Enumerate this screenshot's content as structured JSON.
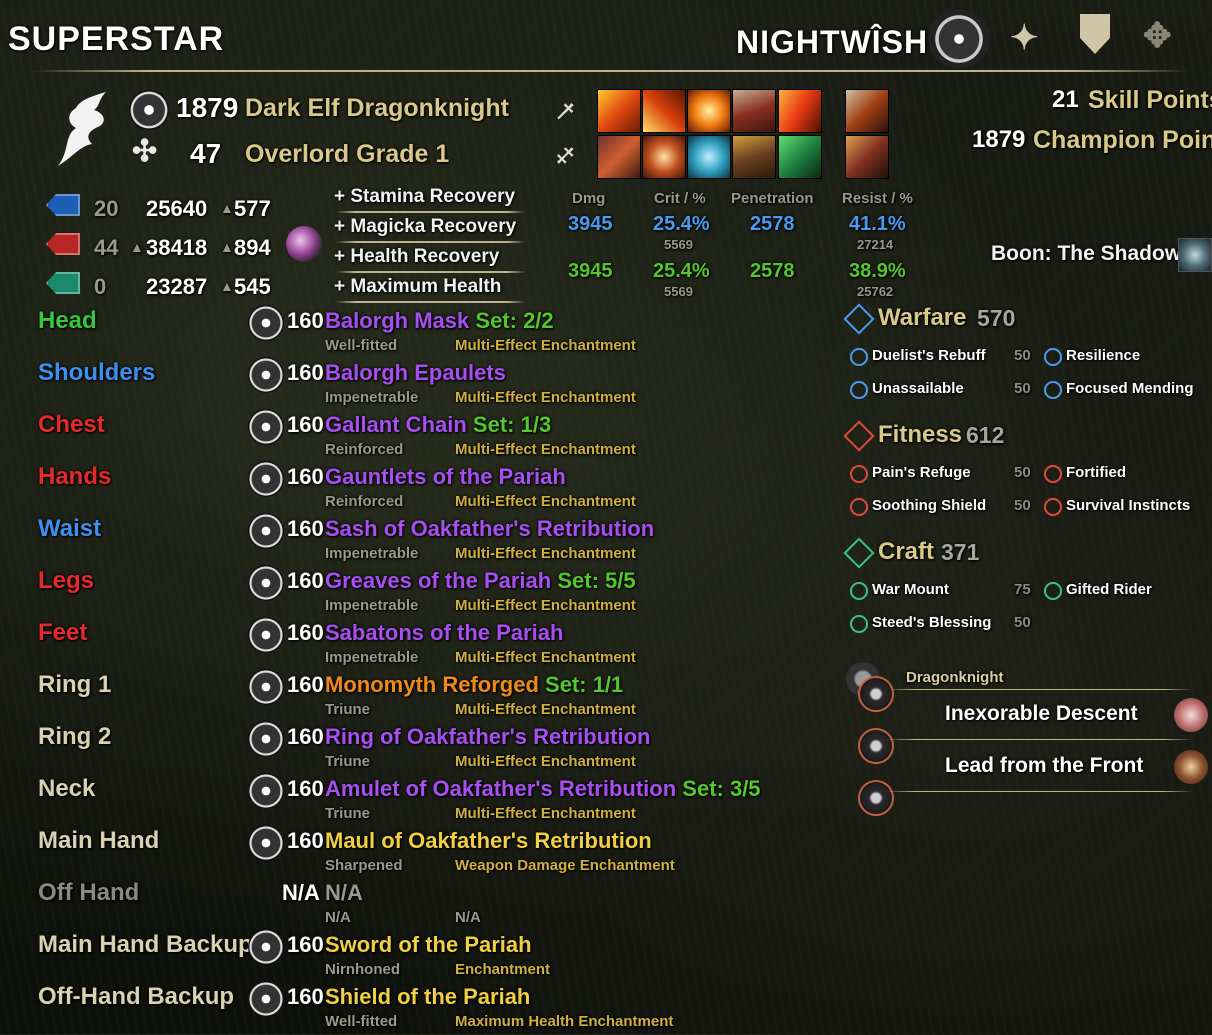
{
  "header": {
    "account": "SUPERSTAR",
    "character": "NIGHTWÎSH",
    "icons": [
      "cp-emblem-icon",
      "alliance-rank-icon",
      "shield-icon",
      "dragon-crest-icon"
    ]
  },
  "profile": {
    "cp": "1879",
    "race_class": "Dark Elf Dragonknight",
    "level": "47",
    "rank": "Overlord Grade 1",
    "skill_points_value": "21",
    "skill_points_label": "Skill Points",
    "champion_points_value": "1879",
    "champion_points_label": "Champion Points"
  },
  "resources": [
    {
      "color": "#1d5fb4",
      "attr": "20",
      "value": "25640",
      "arrow": "▲",
      "regen": "577"
    },
    {
      "color": "#b82626",
      "attr": "44",
      "value": "38418",
      "arrow": "▲",
      "regen": "894",
      "prefix": "▲"
    },
    {
      "color": "#1a8a6c",
      "attr": "0",
      "value": "23287",
      "arrow": "▲",
      "regen": "545"
    }
  ],
  "mundus": [
    "+ Stamina Recovery",
    "+ Magicka Recovery",
    "+ Health Recovery",
    "+ Maximum Health"
  ],
  "combat": {
    "headers": [
      "Dmg",
      "Crit / %",
      "Penetration",
      "Resist / %"
    ],
    "rows": [
      {
        "dmg": "3945",
        "crit": "25.4%",
        "crit_raw": "5569",
        "pen": "2578",
        "resist": "41.1%",
        "resist_raw": "27214",
        "color": "#4a9bf0"
      },
      {
        "dmg": "3945",
        "crit": "25.4%",
        "crit_raw": "5569",
        "pen": "2578",
        "resist": "38.9%",
        "resist_raw": "25762",
        "color": "#54c62e"
      }
    ]
  },
  "boon": "Boon: The Shadow",
  "equipment": [
    {
      "slot": "Head",
      "slot_color": "#37c83a",
      "cp": "160",
      "name": "Balorgh Mask",
      "name_color": "#a74ff0",
      "set": "Set: 2/2",
      "trait": "Well-fitted",
      "ench": "Multi-Effect Enchantment"
    },
    {
      "slot": "Shoulders",
      "slot_color": "#3e8ff0",
      "cp": "160",
      "name": "Balorgh Epaulets",
      "name_color": "#a74ff0",
      "set": "",
      "trait": "Impenetrable",
      "ench": "Multi-Effect Enchantment"
    },
    {
      "slot": "Chest",
      "slot_color": "#e52a2a",
      "cp": "160",
      "name": "Gallant Chain",
      "name_color": "#a74ff0",
      "set": "Set: 1/3",
      "trait": "Reinforced",
      "ench": "Multi-Effect Enchantment"
    },
    {
      "slot": "Hands",
      "slot_color": "#e52a2a",
      "cp": "160",
      "name": "Gauntlets of the Pariah",
      "name_color": "#a74ff0",
      "set": "",
      "trait": "Reinforced",
      "ench": "Multi-Effect Enchantment"
    },
    {
      "slot": "Waist",
      "slot_color": "#3e8ff0",
      "cp": "160",
      "name": "Sash of Oakfather's Retribution",
      "name_color": "#a74ff0",
      "set": "",
      "trait": "Impenetrable",
      "ench": "Multi-Effect Enchantment"
    },
    {
      "slot": "Legs",
      "slot_color": "#e52a2a",
      "cp": "160",
      "name": "Greaves of the Pariah",
      "name_color": "#a74ff0",
      "set": "Set: 5/5",
      "trait": "Impenetrable",
      "ench": "Multi-Effect Enchantment"
    },
    {
      "slot": "Feet",
      "slot_color": "#e52a2a",
      "cp": "160",
      "name": "Sabatons of the Pariah",
      "name_color": "#a74ff0",
      "set": "",
      "trait": "Impenetrable",
      "ench": "Multi-Effect Enchantment"
    },
    {
      "slot": "Ring 1",
      "slot_color": "#d8d2b0",
      "cp": "160",
      "name": "Monomyth Reforged",
      "name_color": "#f08a1a",
      "set": "Set: 1/1",
      "trait": "Triune",
      "ench": "Multi-Effect Enchantment"
    },
    {
      "slot": "Ring 2",
      "slot_color": "#d8d2b0",
      "cp": "160",
      "name": "Ring of Oakfather's Retribution",
      "name_color": "#a74ff0",
      "set": "",
      "trait": "Triune",
      "ench": "Multi-Effect Enchantment"
    },
    {
      "slot": "Neck",
      "slot_color": "#d8d2b0",
      "cp": "160",
      "name": "Amulet of Oakfather's Retribution",
      "name_color": "#a74ff0",
      "set": "Set: 3/5",
      "trait": "Triune",
      "ench": "Multi-Effect Enchantment"
    },
    {
      "slot": "Main Hand",
      "slot_color": "#d8d2b0",
      "cp": "160",
      "name": "Maul of Oakfather's Retribution",
      "name_color": "#f0d040",
      "set": "",
      "trait": "Sharpened",
      "ench": "Weapon Damage Enchantment"
    },
    {
      "slot": "Off Hand",
      "slot_color": "#8a8a80",
      "cp": "N/A",
      "name": "N/A",
      "name_color": "#9a9a8a",
      "set": "",
      "trait": "N/A",
      "ench": "N/A",
      "no_icon": true
    },
    {
      "slot": "Main Hand Backup",
      "slot_color": "#d8d2b0",
      "cp": "160",
      "name": "Sword of the Pariah",
      "name_color": "#f0d040",
      "set": "",
      "trait": "Nirnhoned",
      "ench": "Enchantment"
    },
    {
      "slot": "Off-Hand Backup",
      "slot_color": "#d8d2b0",
      "cp": "160",
      "name": "Shield of the Pariah",
      "name_color": "#f0d040",
      "set": "",
      "trait": "Well-fitted",
      "ench": "Maximum Health Enchantment"
    }
  ],
  "cp_disciplines": [
    {
      "name": "Warfare",
      "value": "570",
      "icon": "warfare-icon",
      "color": "#4a9bf0",
      "stars": [
        [
          "Duelist's Rebuff",
          "50",
          "Resilience"
        ],
        [
          "Unassailable",
          "50",
          "Focused Mending"
        ]
      ]
    },
    {
      "name": "Fitness",
      "value": "612",
      "icon": "fitness-icon",
      "color": "#e04a3a",
      "stars": [
        [
          "Pain's Refuge",
          "50",
          "Fortified"
        ],
        [
          "Soothing Shield",
          "50",
          "Survival Instincts"
        ]
      ]
    },
    {
      "name": "Craft",
      "value": "371",
      "icon": "craft-icon",
      "color": "#3ac08a",
      "stars": [
        [
          "War Mount",
          "75",
          "Gifted Rider"
        ],
        [
          "Steed's Blessing",
          "50",
          ""
        ]
      ]
    }
  ],
  "class_skills": {
    "header": "Dragonknight",
    "items": [
      "Inexorable Descent",
      "Lead from the Front"
    ]
  }
}
